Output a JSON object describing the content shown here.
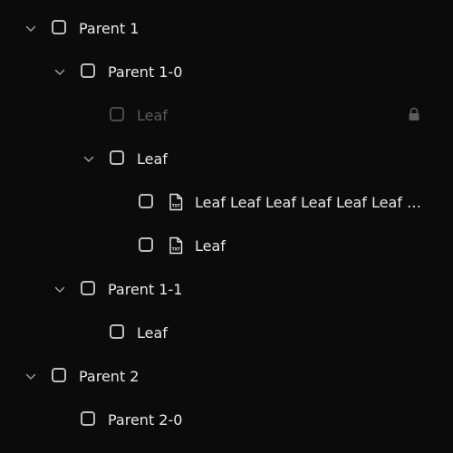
{
  "tree": {
    "items": [
      {
        "label": "Parent 1"
      },
      {
        "label": "Parent 1-0"
      },
      {
        "label": "Leaf"
      },
      {
        "label": "Leaf"
      },
      {
        "label": "Leaf Leaf Leaf Leaf Leaf Leaf L..."
      },
      {
        "label": "Leaf"
      },
      {
        "label": "Parent 1-1"
      },
      {
        "label": "Leaf"
      },
      {
        "label": "Parent 2"
      },
      {
        "label": "Parent 2-0"
      }
    ],
    "file_icon_text": "TXT"
  },
  "colors": {
    "background": "#0b0b0b",
    "text": "#e9e9e9",
    "disabled_text": "#5c5c5c",
    "checkbox_border": "#bdbdbd",
    "disabled_checkbox_border": "#4a4a4a",
    "chevron": "#9a9a9a"
  },
  "icons": {
    "expand": "chevron-down-icon",
    "file": "txt-file-icon",
    "locked": "lock-icon"
  }
}
